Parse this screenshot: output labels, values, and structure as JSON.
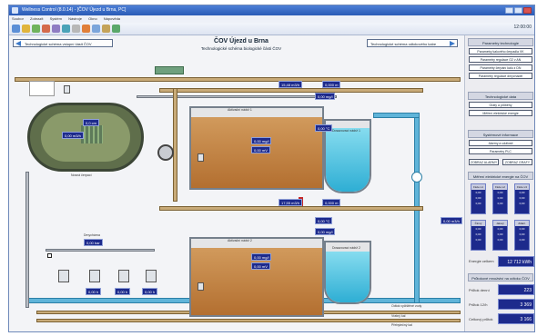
{
  "window": {
    "title": "Wellness Control (8.0.14) - [ČOV Újezd u Brna, PC]",
    "clock": "12:00:00"
  },
  "menu": [
    "Soubor",
    "Zobrazit",
    "Systém",
    "Nástroje",
    "Okno",
    "Nápověda"
  ],
  "header": {
    "left_button": "Technologické schéma vstupní čásit ČOV",
    "right_button": "Technologické schéma odtokového kabe",
    "title": "ČOV Újezd u Brna",
    "subtitle": "Technologické schéma biologické části ČOV"
  },
  "process_values": {
    "inlet_flow": "0,00 m3/h",
    "oxygen_1": "0,00 mg/l",
    "oxygen_2": "0,00 mg/l",
    "tank_level": "0,0 cm",
    "line1_flow": "15,48 m3/h",
    "line1_level": "0,000 m",
    "line1_temp": "0,00 °C",
    "line1_o2": "0,00 mg/l",
    "line1_redox": "0,00 mV",
    "line2_flow": "17,55 m3/h",
    "line2_level": "0,000 m",
    "line2_temp": "0,00 °C",
    "line2_o2": "0,00 mg/l",
    "line2_redox": "0,00 mV",
    "return_flow": "0,00 m3/h",
    "blower_1": "0,00 h",
    "blower_2": "0,00 h",
    "blower_3": "0,00 h",
    "blower_pressure": "0,00 bar"
  },
  "labels": {
    "tank_outlet": "Nosná čerpací",
    "aeration_1": "Aktivační nádrž 1",
    "aeration_2": "Aktivační nádrž 2",
    "settling_1": "Dosazovací nádrž 1",
    "settling_2": "Dosazovací nádrž 2",
    "outlet": "Odtok vyčištěné vody",
    "return_sludge": "Vratný kal",
    "excess_sludge": "Přebytečný kal",
    "blower_station": "Dmychárna"
  },
  "sidebar": {
    "sections": {
      "params": "Parametry technologie",
      "trends": "Technologické data",
      "system": "Systémové informace",
      "energy": "Měření elektrické energie na ČOV",
      "totals": "Průtokové množství na odtoku ČOV"
    },
    "param_buttons": [
      "Parametry kalového čerpadla VK",
      "Parametry regulace O2 v AN",
      "Parametry čerpání kalu z DN",
      "Parametry regulace dmychadel"
    ],
    "trend_buttons": [
      "Grafy a průběhy",
      "Měření elektrické energie"
    ],
    "system_buttons": [
      "Alarmy a události",
      "Parametry PLC"
    ],
    "pair_buttons": [
      "ZOBRAZ ALARMY",
      "ZOBRAZ GRAFY"
    ],
    "energy_headers": [
      "Fáze L1",
      "Fáze L2",
      "Fáze L3"
    ],
    "energy_rows": [
      [
        "0,00",
        "0,00",
        "0,00"
      ],
      [
        "0,00",
        "0,00",
        "0,00"
      ],
      [
        "0,00",
        "0,00",
        "0,00"
      ]
    ],
    "energy_headers_2": [
      "Činný",
      "Jalový",
      "Zdánl."
    ],
    "energy_rows_2": [
      [
        "0,00",
        "0,00",
        "0,00"
      ],
      [
        "0,00",
        "0,00",
        "0,00"
      ],
      [
        "0,00",
        "0,00",
        "0,00"
      ]
    ],
    "energy_total_label": "Energie celkem",
    "energy_total": "12 712 kWh",
    "totals": [
      {
        "label": "Průtok denní",
        "value": "223"
      },
      {
        "label": "Průtok 12/h",
        "value": "3 369"
      },
      {
        "label": "Celkový průtok",
        "value": "3 166"
      }
    ]
  }
}
